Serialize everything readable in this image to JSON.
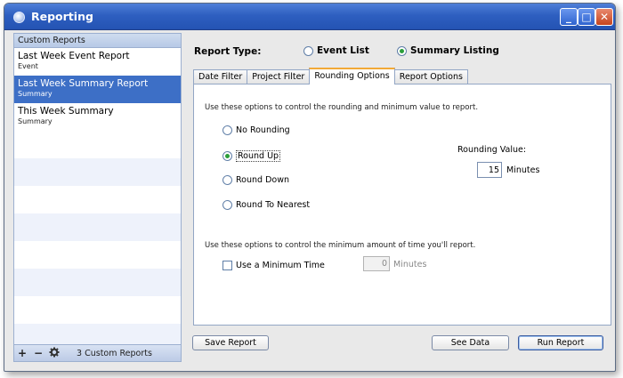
{
  "window": {
    "title": "Reporting",
    "buttons": {
      "minimize": "_",
      "maximize": "□",
      "close": "✕"
    }
  },
  "sidebar": {
    "header": "Custom Reports",
    "items": [
      {
        "name": "Last Week Event Report",
        "type": "Event"
      },
      {
        "name": "Last Week Summary Report",
        "type": "Summary",
        "selected": true
      },
      {
        "name": "This Week Summary",
        "type": "Summary"
      }
    ],
    "footer": {
      "add": "+",
      "remove": "−",
      "count_label": "3 Custom Reports"
    }
  },
  "report_type": {
    "label": "Report Type:",
    "options": [
      "Event List",
      "Summary Listing"
    ],
    "selected": "Summary Listing"
  },
  "tabs": [
    {
      "label": "Date Filter"
    },
    {
      "label": "Project Filter"
    },
    {
      "label": "Rounding Options",
      "active": true
    },
    {
      "label": "Report Options"
    }
  ],
  "rounding": {
    "intro": "Use these options to control the rounding and minimum value to report.",
    "options": [
      "No Rounding",
      "Round Up",
      "Round Down",
      "Round To Nearest"
    ],
    "selected": "Round Up",
    "value_label": "Rounding Value:",
    "value": "15",
    "value_unit": "Minutes"
  },
  "minimum": {
    "intro": "Use these options to control the minimum amount of time you'll report.",
    "checkbox_label": "Use a Minimum Time",
    "checked": false,
    "value": "0",
    "unit": "Minutes"
  },
  "buttons": {
    "save": "Save Report",
    "see_data": "See Data",
    "run": "Run Report"
  },
  "colors": {
    "title_bar": "#2e5fc0",
    "selection": "#3d6fc6",
    "active_tab_accent": "#f2a937",
    "radio_dot": "#2a9e3a"
  }
}
